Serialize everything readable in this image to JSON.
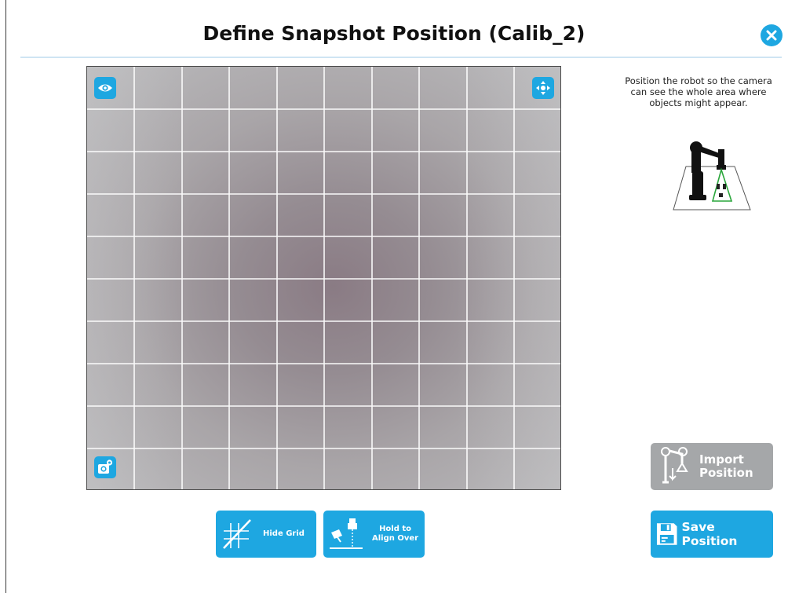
{
  "header": {
    "title": "Define Snapshot Position (Calib_2)"
  },
  "icons": {
    "close": "close-icon",
    "eye": "eye-icon",
    "move": "move-arrows-icon",
    "camera_settings": "camera-settings-icon",
    "hide_grid": "grid-slash-icon",
    "align_over": "robot-align-icon",
    "import": "robot-import-icon",
    "save": "floppy-disk-icon"
  },
  "instructions": {
    "line1": "Position the robot so the camera",
    "line2": "can see the whole area where",
    "line3": "objects might appear."
  },
  "toolbar": {
    "hide_grid_label": "Hide Grid",
    "align_line1": "Hold to",
    "align_line2": "Align Over"
  },
  "side_actions": {
    "import_line1": "Import",
    "import_line2": "Position",
    "save_label": "Save Position"
  },
  "colors": {
    "accent": "#1ea7e1",
    "disabled": "#a5a7a9",
    "grid_line": "#ffffff"
  },
  "camera_view": {
    "grid_visible": true,
    "grid_columns": 10,
    "grid_rows": 10
  }
}
